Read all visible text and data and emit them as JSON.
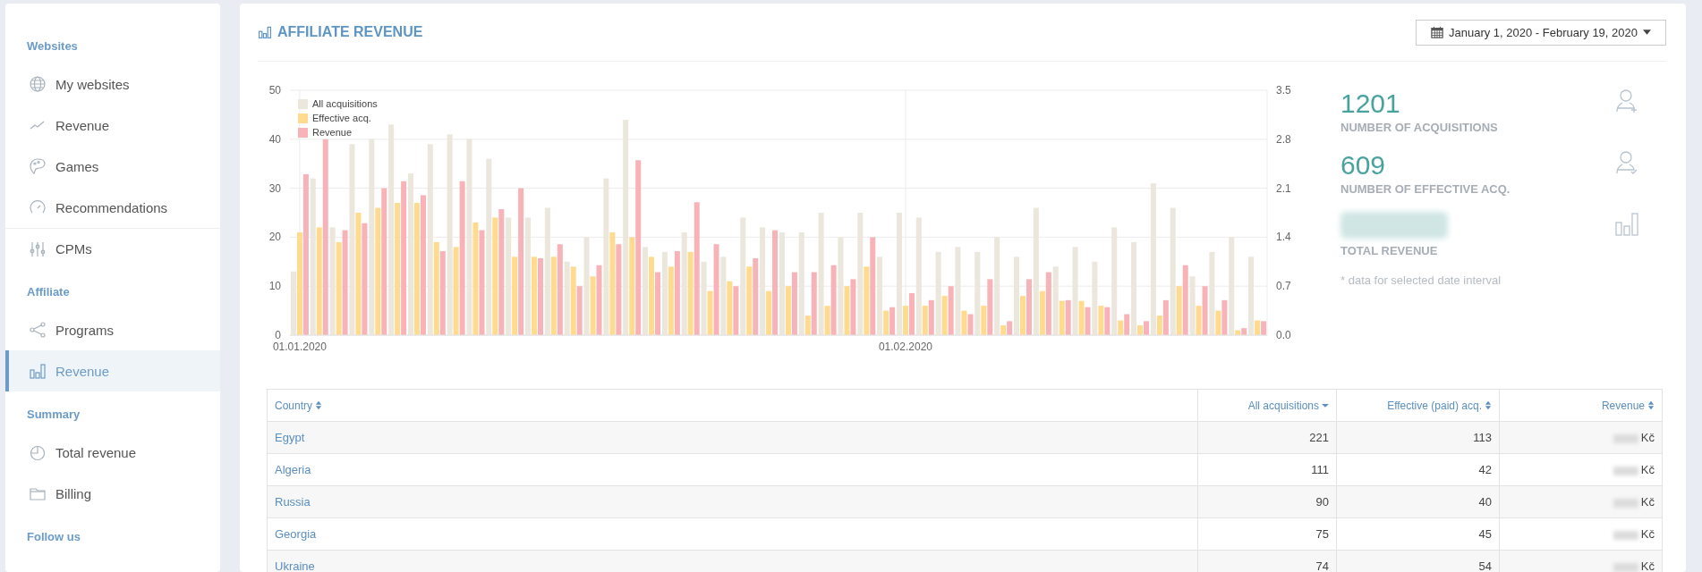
{
  "sidebar": {
    "sections": [
      {
        "heading": "Websites",
        "items": [
          {
            "label": "My websites",
            "selected": false
          },
          {
            "label": "Revenue",
            "selected": false
          },
          {
            "label": "Games",
            "selected": false
          },
          {
            "label": "Recommendations",
            "selected": false
          },
          {
            "label": "CPMs",
            "selected": false
          }
        ]
      },
      {
        "heading": "Affiliate",
        "items": [
          {
            "label": "Programs",
            "selected": false
          },
          {
            "label": "Revenue",
            "selected": true
          }
        ]
      },
      {
        "heading": "Summary",
        "items": [
          {
            "label": "Total revenue",
            "selected": false
          },
          {
            "label": "Billing",
            "selected": false
          }
        ]
      },
      {
        "heading": "Follow us"
      }
    ]
  },
  "main": {
    "title": "AFFILIATE REVENUE",
    "date_range": "January 1, 2020 - February 19, 2020",
    "chart_data": {
      "type": "bar",
      "annotations": [
        "01.01.2020",
        "01.02.2020"
      ],
      "grid": true,
      "legend": "top-left",
      "ylim": [
        0,
        50
      ],
      "yticks": [
        {
          "value": 0,
          "label": "0"
        },
        {
          "value": 10,
          "label": "10"
        },
        {
          "value": 20,
          "label": "20"
        },
        {
          "value": 30,
          "label": "30"
        },
        {
          "value": 40,
          "label": "40"
        },
        {
          "value": 50,
          "label": "50"
        }
      ],
      "y2lim": [
        0,
        3.5
      ],
      "y2ticks": [
        {
          "value": 0,
          "label": "0.0"
        },
        {
          "value": 0.7,
          "label": "0.7"
        },
        {
          "value": 1.4,
          "label": "1.4"
        },
        {
          "value": 2.1,
          "label": "2.1"
        },
        {
          "value": 2.8,
          "label": "2.8"
        },
        {
          "value": 3.5,
          "label": "3.5"
        }
      ],
      "series": [
        {
          "name": "All acquisitions",
          "color": "#ebe7dd",
          "values": [
            13,
            32,
            22,
            39,
            40,
            43,
            33,
            39,
            41,
            40,
            36,
            24,
            24,
            26,
            15,
            20,
            32,
            44,
            18,
            17,
            21,
            15,
            16,
            24,
            22,
            21,
            21,
            25,
            20,
            25,
            16,
            25,
            24,
            17,
            18,
            17,
            20,
            16,
            26,
            14,
            18,
            15,
            22,
            19,
            31,
            26,
            12,
            17,
            20,
            16
          ]
        },
        {
          "name": "Effective acq.",
          "color": "#ffdb8f",
          "values": [
            21,
            22,
            19,
            25,
            26,
            27,
            27,
            19,
            18,
            23,
            24,
            16,
            16,
            16,
            14,
            12,
            21,
            20,
            16,
            14,
            17,
            9,
            11,
            14,
            9,
            10,
            4,
            6,
            10,
            14,
            5,
            6,
            6,
            8,
            5,
            6,
            2,
            8,
            9,
            7,
            7,
            6,
            3,
            2,
            4,
            10,
            6,
            5,
            1,
            3
          ]
        },
        {
          "name": "Revenue",
          "color": "#f7b3b8",
          "axis": "y2",
          "values": [
            2.3,
            2.8,
            1.5,
            1.6,
            2.1,
            2.2,
            2.0,
            1.2,
            2.2,
            1.5,
            1.8,
            2.1,
            1.1,
            1.3,
            0.7,
            1.0,
            1.3,
            2.5,
            0.9,
            1.2,
            1.9,
            1.3,
            0.7,
            1.1,
            1.5,
            0.9,
            0.9,
            1.0,
            0.8,
            1.4,
            0.4,
            0.6,
            0.5,
            0.7,
            0.3,
            0.8,
            0.2,
            0.8,
            0.9,
            0.5,
            0.4,
            0.4,
            0.3,
            0.2,
            0.5,
            1.0,
            0.7,
            0.5,
            0.1,
            0.2
          ]
        }
      ]
    },
    "stats": [
      {
        "kind": "number",
        "value": "1201",
        "label": "NUMBER OF ACQUISITIONS"
      },
      {
        "kind": "number",
        "value": "609",
        "label": "NUMBER OF EFFECTIVE ACQ."
      },
      {
        "kind": "redacted",
        "label": "TOTAL REVENUE"
      }
    ],
    "note": "* data for selected date interval",
    "table": {
      "columns": [
        {
          "label": "Country",
          "sorted": false
        },
        {
          "label": "All acquisitions",
          "sorted": true
        },
        {
          "label": "Effective (paid) acq.",
          "sorted": false
        },
        {
          "label": "Revenue",
          "sorted": false
        }
      ],
      "rows": [
        {
          "country": "Egypt",
          "all": "221",
          "effective": "113",
          "revenue_currency": "Kč"
        },
        {
          "country": "Algeria",
          "all": "111",
          "effective": "42",
          "revenue_currency": "Kč"
        },
        {
          "country": "Russia",
          "all": "90",
          "effective": "40",
          "revenue_currency": "Kč"
        },
        {
          "country": "Georgia",
          "all": "75",
          "effective": "45",
          "revenue_currency": "Kč"
        },
        {
          "country": "Ukraine",
          "all": "74",
          "effective": "54",
          "revenue_currency": "Kč"
        }
      ]
    }
  }
}
